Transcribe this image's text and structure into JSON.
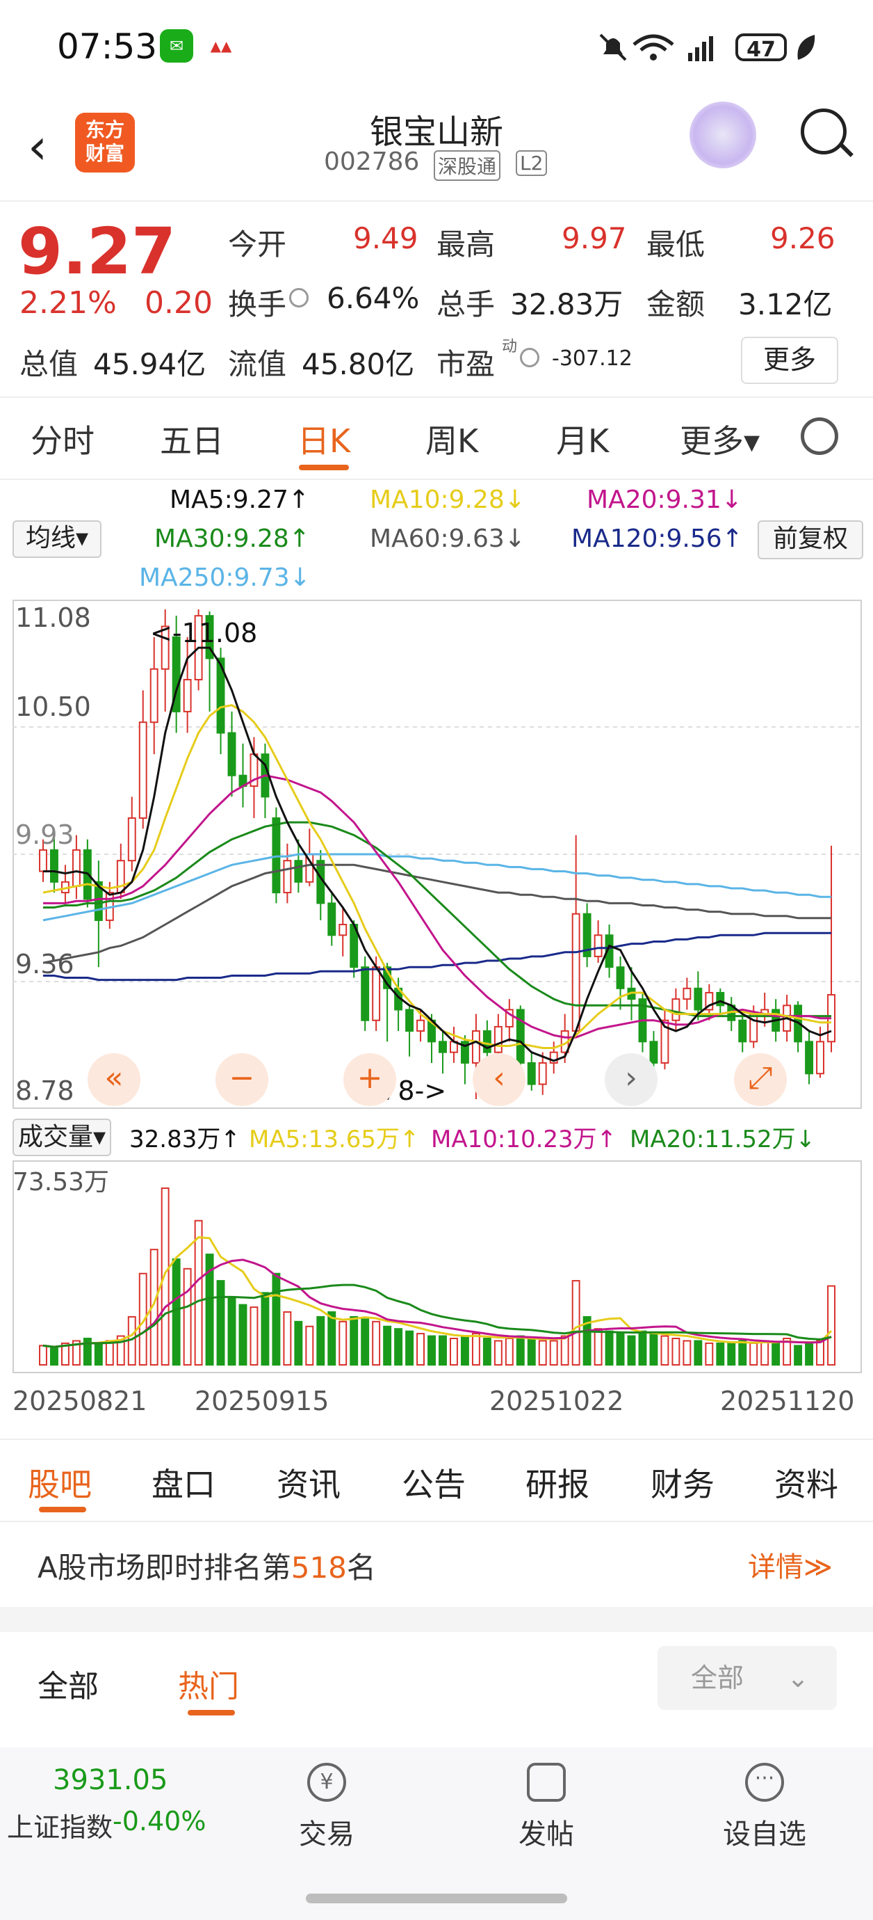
{
  "status_bar": {
    "time": "07:53",
    "battery": "47"
  },
  "header": {
    "logo_text_line1": "东方",
    "logo_text_line2": "财富",
    "stock_name": "银宝山新",
    "stock_code": "002786",
    "tag_connect": "深股通",
    "tag_level": "L2"
  },
  "quote": {
    "price": "9.27",
    "change_pct": "2.21%",
    "change_amt": "0.20",
    "open_label": "今开",
    "open": "9.49",
    "high_label": "最高",
    "high": "9.97",
    "low_label": "最低",
    "low": "9.26",
    "turnover_label": "换手",
    "turnover": "6.64%",
    "volume_label": "总手",
    "volume": "32.83万",
    "amount_label": "金额",
    "amount": "3.12亿",
    "mktcap_label": "总值",
    "mktcap": "45.94亿",
    "float_label": "流值",
    "float_cap": "45.80亿",
    "pe_label": "市盈",
    "pe_sup": "动",
    "pe": "-307.12",
    "more": "更多"
  },
  "k_tabs": [
    "分时",
    "五日",
    "日K",
    "周K",
    "月K",
    "更多▾"
  ],
  "ma_legend": {
    "selector": "均线▾",
    "adjust": "前复权",
    "ma5": "MA5:9.27↑",
    "ma10": "MA10:9.28↓",
    "ma20": "MA20:9.31↓",
    "ma30": "MA30:9.28↑",
    "ma60": "MA60:9.63↓",
    "ma120": "MA120:9.56↑",
    "ma250": "MA250:9.73↓"
  },
  "colors": {
    "up": "#d9322c",
    "down": "#1a9a1a",
    "accent": "#e8641c",
    "ma5": "#111111",
    "ma10": "#e6cc1a",
    "ma20": "#c2158c",
    "ma30": "#1a8a1a",
    "ma60": "#555555",
    "ma120": "#1a2a8a",
    "ma250": "#5ab4e6"
  },
  "price_axis": [
    "11.08",
    "10.50",
    "9.93",
    "9.36",
    "8.78"
  ],
  "price_marks": {
    "max": "<-11.08",
    "min": "8.78->"
  },
  "volume_legend": {
    "selector": "成交量▾",
    "vol": "32.83万↑",
    "ma5": "MA5:13.65万↑",
    "ma10": "MA10:10.23万↑",
    "ma20": "MA20:11.52万↓",
    "max_label": "73.53万"
  },
  "date_axis": [
    "20250821",
    "20250915",
    "20251022",
    "20251120"
  ],
  "chart_data": {
    "type": "candlestick",
    "ylim": [
      8.78,
      11.08
    ],
    "candles": [
      {
        "o": 9.85,
        "c": 9.95,
        "h": 10.0,
        "l": 9.8,
        "v": 8
      },
      {
        "o": 9.95,
        "c": 9.8,
        "h": 10.05,
        "l": 9.75,
        "v": 7
      },
      {
        "o": 9.75,
        "c": 9.8,
        "h": 9.88,
        "l": 9.7,
        "v": 9
      },
      {
        "o": 9.78,
        "c": 9.95,
        "h": 10.02,
        "l": 9.72,
        "v": 10
      },
      {
        "o": 9.95,
        "c": 9.72,
        "h": 10.0,
        "l": 9.68,
        "v": 11
      },
      {
        "o": 9.8,
        "c": 9.62,
        "h": 9.9,
        "l": 9.4,
        "v": 9
      },
      {
        "o": 9.62,
        "c": 9.75,
        "h": 9.8,
        "l": 9.58,
        "v": 10
      },
      {
        "o": 9.75,
        "c": 9.9,
        "h": 9.98,
        "l": 9.72,
        "v": 12
      },
      {
        "o": 9.9,
        "c": 10.1,
        "h": 10.2,
        "l": 9.85,
        "v": 20
      },
      {
        "o": 10.1,
        "c": 10.55,
        "h": 10.7,
        "l": 10.05,
        "v": 38
      },
      {
        "o": 10.55,
        "c": 10.8,
        "h": 10.95,
        "l": 10.4,
        "v": 48
      },
      {
        "o": 10.8,
        "c": 11.0,
        "h": 11.08,
        "l": 10.6,
        "v": 73.53
      },
      {
        "o": 10.95,
        "c": 10.6,
        "h": 11.05,
        "l": 10.5,
        "v": 44
      },
      {
        "o": 10.6,
        "c": 10.75,
        "h": 10.95,
        "l": 10.5,
        "v": 40
      },
      {
        "o": 10.75,
        "c": 11.05,
        "h": 11.08,
        "l": 10.7,
        "v": 60
      },
      {
        "o": 11.05,
        "c": 10.85,
        "h": 11.07,
        "l": 10.6,
        "v": 46
      },
      {
        "o": 10.85,
        "c": 10.5,
        "h": 10.9,
        "l": 10.4,
        "v": 35
      },
      {
        "o": 10.5,
        "c": 10.3,
        "h": 10.6,
        "l": 10.2,
        "v": 28
      },
      {
        "o": 10.3,
        "c": 10.25,
        "h": 10.45,
        "l": 10.15,
        "v": 25
      },
      {
        "o": 10.25,
        "c": 10.4,
        "h": 10.48,
        "l": 10.1,
        "v": 24
      },
      {
        "o": 10.4,
        "c": 10.2,
        "h": 10.45,
        "l": 10.1,
        "v": 30
      },
      {
        "o": 10.1,
        "c": 9.75,
        "h": 10.15,
        "l": 9.7,
        "v": 38
      },
      {
        "o": 9.75,
        "c": 9.9,
        "h": 9.98,
        "l": 9.7,
        "v": 22
      },
      {
        "o": 9.9,
        "c": 9.8,
        "h": 10.0,
        "l": 9.75,
        "v": 18
      },
      {
        "o": 9.8,
        "c": 9.93,
        "h": 10.05,
        "l": 9.78,
        "v": 16
      },
      {
        "o": 9.9,
        "c": 9.7,
        "h": 9.95,
        "l": 9.62,
        "v": 20
      },
      {
        "o": 9.7,
        "c": 9.55,
        "h": 9.75,
        "l": 9.5,
        "v": 22
      },
      {
        "o": 9.55,
        "c": 9.6,
        "h": 9.68,
        "l": 9.45,
        "v": 18
      },
      {
        "o": 9.6,
        "c": 9.4,
        "h": 9.62,
        "l": 9.35,
        "v": 20
      },
      {
        "o": 9.4,
        "c": 9.15,
        "h": 9.45,
        "l": 9.1,
        "v": 19
      },
      {
        "o": 9.15,
        "c": 9.4,
        "h": 9.45,
        "l": 9.1,
        "v": 18
      },
      {
        "o": 9.4,
        "c": 9.3,
        "h": 9.42,
        "l": 9.05,
        "v": 16
      },
      {
        "o": 9.3,
        "c": 9.2,
        "h": 9.35,
        "l": 9.1,
        "v": 15
      },
      {
        "o": 9.2,
        "c": 9.1,
        "h": 9.22,
        "l": 8.98,
        "v": 14
      },
      {
        "o": 9.1,
        "c": 9.15,
        "h": 9.2,
        "l": 9.05,
        "v": 13
      },
      {
        "o": 9.15,
        "c": 9.05,
        "h": 9.18,
        "l": 8.95,
        "v": 12
      },
      {
        "o": 9.05,
        "c": 9.0,
        "h": 9.1,
        "l": 8.9,
        "v": 12
      },
      {
        "o": 9.0,
        "c": 9.05,
        "h": 9.12,
        "l": 8.95,
        "v": 11
      },
      {
        "o": 9.05,
        "c": 8.95,
        "h": 9.08,
        "l": 8.85,
        "v": 12
      },
      {
        "o": 8.95,
        "c": 9.1,
        "h": 9.18,
        "l": 8.78,
        "v": 13
      },
      {
        "o": 9.1,
        "c": 9.0,
        "h": 9.15,
        "l": 8.95,
        "v": 11
      },
      {
        "o": 9.0,
        "c": 9.12,
        "h": 9.18,
        "l": 8.95,
        "v": 10
      },
      {
        "o": 9.12,
        "c": 9.2,
        "h": 9.25,
        "l": 9.05,
        "v": 11
      },
      {
        "o": 9.2,
        "c": 8.95,
        "h": 9.22,
        "l": 8.9,
        "v": 12
      },
      {
        "o": 8.95,
        "c": 8.85,
        "h": 9.0,
        "l": 8.82,
        "v": 11
      },
      {
        "o": 8.85,
        "c": 8.95,
        "h": 9.0,
        "l": 8.8,
        "v": 10
      },
      {
        "o": 8.95,
        "c": 9.0,
        "h": 9.05,
        "l": 8.9,
        "v": 10
      },
      {
        "o": 9.0,
        "c": 9.1,
        "h": 9.18,
        "l": 8.95,
        "v": 12
      },
      {
        "o": 9.1,
        "c": 9.65,
        "h": 10.02,
        "l": 9.08,
        "v": 35
      },
      {
        "o": 9.65,
        "c": 9.45,
        "h": 9.7,
        "l": 9.4,
        "v": 20
      },
      {
        "o": 9.45,
        "c": 9.55,
        "h": 9.62,
        "l": 9.42,
        "v": 15
      },
      {
        "o": 9.55,
        "c": 9.4,
        "h": 9.6,
        "l": 9.35,
        "v": 14
      },
      {
        "o": 9.4,
        "c": 9.3,
        "h": 9.45,
        "l": 9.2,
        "v": 13
      },
      {
        "o": 9.3,
        "c": 9.25,
        "h": 9.4,
        "l": 9.15,
        "v": 12
      },
      {
        "o": 9.25,
        "c": 9.05,
        "h": 9.28,
        "l": 9.0,
        "v": 14
      },
      {
        "o": 9.05,
        "c": 8.95,
        "h": 9.1,
        "l": 8.9,
        "v": 13
      },
      {
        "o": 8.95,
        "c": 9.15,
        "h": 9.2,
        "l": 8.92,
        "v": 12
      },
      {
        "o": 9.15,
        "c": 9.25,
        "h": 9.3,
        "l": 9.1,
        "v": 11
      },
      {
        "o": 9.25,
        "c": 9.3,
        "h": 9.35,
        "l": 9.2,
        "v": 10
      },
      {
        "o": 9.3,
        "c": 9.2,
        "h": 9.38,
        "l": 9.15,
        "v": 10
      },
      {
        "o": 9.2,
        "c": 9.28,
        "h": 9.32,
        "l": 9.15,
        "v": 9
      },
      {
        "o": 9.28,
        "c": 9.22,
        "h": 9.3,
        "l": 9.18,
        "v": 9
      },
      {
        "o": 9.22,
        "c": 9.15,
        "h": 9.26,
        "l": 9.1,
        "v": 9
      },
      {
        "o": 9.15,
        "c": 9.05,
        "h": 9.2,
        "l": 9.0,
        "v": 10
      },
      {
        "o": 9.05,
        "c": 9.18,
        "h": 9.22,
        "l": 9.02,
        "v": 9
      },
      {
        "o": 9.18,
        "c": 9.2,
        "h": 9.28,
        "l": 9.12,
        "v": 10
      },
      {
        "o": 9.2,
        "c": 9.1,
        "h": 9.25,
        "l": 9.05,
        "v": 9
      },
      {
        "o": 9.1,
        "c": 9.22,
        "h": 9.27,
        "l": 9.05,
        "v": 11
      },
      {
        "o": 9.22,
        "c": 9.05,
        "h": 9.24,
        "l": 9.0,
        "v": 8
      },
      {
        "o": 9.05,
        "c": 8.9,
        "h": 9.1,
        "l": 8.85,
        "v": 9
      },
      {
        "o": 8.9,
        "c": 9.05,
        "h": 9.12,
        "l": 8.88,
        "v": 10
      },
      {
        "o": 9.05,
        "c": 9.27,
        "h": 9.97,
        "l": 9.0,
        "v": 32.83
      }
    ],
    "ma_lines": {
      "ma5": [
        9.85,
        9.85,
        9.84,
        9.85,
        9.84,
        9.78,
        9.74,
        9.75,
        9.8,
        9.95,
        10.2,
        10.5,
        10.7,
        10.85,
        10.9,
        10.9,
        10.82,
        10.7,
        10.55,
        10.4,
        10.35,
        10.2,
        10.08,
        9.98,
        9.9,
        9.82,
        9.75,
        9.68,
        9.6,
        9.48,
        9.4,
        9.32,
        9.26,
        9.22,
        9.2,
        9.15,
        9.1,
        9.05,
        9.03,
        9.05,
        9.02,
        9.04,
        9.06,
        9.05,
        9.0,
        8.98,
        8.96,
        8.98,
        9.1,
        9.25,
        9.38,
        9.5,
        9.48,
        9.38,
        9.3,
        9.2,
        9.12,
        9.1,
        9.12,
        9.18,
        9.22,
        9.24,
        9.22,
        9.18,
        9.15,
        9.14,
        9.15,
        9.16,
        9.14,
        9.1,
        9.08,
        9.1
      ],
      "ma10": [
        9.75,
        9.76,
        9.77,
        9.78,
        9.79,
        9.78,
        9.77,
        9.78,
        9.8,
        9.86,
        9.95,
        10.1,
        10.24,
        10.38,
        10.5,
        10.58,
        10.62,
        10.63,
        10.6,
        10.55,
        10.48,
        10.38,
        10.28,
        10.18,
        10.08,
        10.0,
        9.9,
        9.8,
        9.7,
        9.58,
        9.48,
        9.38,
        9.3,
        9.24,
        9.18,
        9.14,
        9.1,
        9.08,
        9.06,
        9.05,
        9.04,
        9.03,
        9.03,
        9.04,
        9.03,
        9.02,
        9.02,
        9.04,
        9.08,
        9.13,
        9.18,
        9.22,
        9.26,
        9.28,
        9.28,
        9.24,
        9.2,
        9.18,
        9.18,
        9.18,
        9.18,
        9.18,
        9.19,
        9.19,
        9.18,
        9.18,
        9.18,
        9.17,
        9.16,
        9.15,
        9.14,
        9.14
      ],
      "ma20": [
        9.7,
        9.7,
        9.7,
        9.71,
        9.71,
        9.72,
        9.72,
        9.73,
        9.75,
        9.78,
        9.83,
        9.88,
        9.94,
        10.0,
        10.06,
        10.12,
        10.17,
        10.22,
        10.25,
        10.28,
        10.3,
        10.29,
        10.28,
        10.26,
        10.24,
        10.22,
        10.18,
        10.13,
        10.08,
        10.01,
        9.94,
        9.87,
        9.8,
        9.72,
        9.64,
        9.56,
        9.48,
        9.42,
        9.36,
        9.31,
        9.26,
        9.22,
        9.18,
        9.15,
        9.12,
        9.1,
        9.08,
        9.07,
        9.07,
        9.09,
        9.11,
        9.12,
        9.13,
        9.14,
        9.15,
        9.15,
        9.14,
        9.13,
        9.13,
        9.14,
        9.16,
        9.18,
        9.19,
        9.2,
        9.19,
        9.18,
        9.17,
        9.17,
        9.17,
        9.17,
        9.16,
        9.16
      ],
      "ma30": [
        9.68,
        9.68,
        9.69,
        9.69,
        9.7,
        9.7,
        9.71,
        9.71,
        9.72,
        9.74,
        9.76,
        9.79,
        9.82,
        9.86,
        9.9,
        9.94,
        9.97,
        10.0,
        10.02,
        10.04,
        10.06,
        10.07,
        10.08,
        10.08,
        10.08,
        10.07,
        10.06,
        10.04,
        10.02,
        9.99,
        9.96,
        9.92,
        9.88,
        9.84,
        9.79,
        9.74,
        9.69,
        9.64,
        9.59,
        9.54,
        9.49,
        9.44,
        9.39,
        9.35,
        9.31,
        9.28,
        9.25,
        9.23,
        9.22,
        9.22,
        9.22,
        9.22,
        9.22,
        9.22,
        9.22,
        9.21,
        9.2,
        9.19,
        9.18,
        9.17,
        9.17,
        9.17,
        9.17,
        9.17,
        9.17,
        9.17,
        9.17,
        9.17,
        9.17,
        9.17,
        9.17,
        9.17
      ],
      "ma60": [
        9.42,
        9.43,
        9.44,
        9.45,
        9.46,
        9.47,
        9.49,
        9.5,
        9.52,
        9.54,
        9.57,
        9.6,
        9.63,
        9.66,
        9.69,
        9.72,
        9.75,
        9.78,
        9.8,
        9.82,
        9.84,
        9.85,
        9.86,
        9.87,
        9.88,
        9.88,
        9.88,
        9.88,
        9.88,
        9.87,
        9.86,
        9.85,
        9.84,
        9.83,
        9.82,
        9.81,
        9.8,
        9.79,
        9.78,
        9.77,
        9.76,
        9.75,
        9.75,
        9.74,
        9.74,
        9.73,
        9.73,
        9.72,
        9.72,
        9.71,
        9.71,
        9.7,
        9.7,
        9.7,
        9.69,
        9.69,
        9.68,
        9.68,
        9.67,
        9.67,
        9.66,
        9.66,
        9.65,
        9.65,
        9.65,
        9.64,
        9.64,
        9.64,
        9.63,
        9.63,
        9.63,
        9.63
      ],
      "ma120": [
        9.36,
        9.36,
        9.35,
        9.35,
        9.35,
        9.34,
        9.34,
        9.34,
        9.34,
        9.34,
        9.34,
        9.34,
        9.34,
        9.35,
        9.35,
        9.35,
        9.35,
        9.36,
        9.36,
        9.36,
        9.36,
        9.37,
        9.37,
        9.37,
        9.37,
        9.38,
        9.38,
        9.38,
        9.38,
        9.39,
        9.39,
        9.39,
        9.39,
        9.4,
        9.4,
        9.4,
        9.41,
        9.41,
        9.42,
        9.42,
        9.43,
        9.43,
        9.44,
        9.44,
        9.45,
        9.45,
        9.46,
        9.47,
        9.47,
        9.48,
        9.49,
        9.49,
        9.5,
        9.51,
        9.51,
        9.52,
        9.52,
        9.53,
        9.53,
        9.54,
        9.54,
        9.55,
        9.55,
        9.55,
        9.55,
        9.56,
        9.56,
        9.56,
        9.56,
        9.56,
        9.56,
        9.56
      ],
      "ma250": [
        9.62,
        9.63,
        9.64,
        9.65,
        9.66,
        9.67,
        9.68,
        9.69,
        9.7,
        9.72,
        9.74,
        9.76,
        9.78,
        9.8,
        9.82,
        9.84,
        9.86,
        9.88,
        9.89,
        9.9,
        9.91,
        9.92,
        9.92,
        9.93,
        9.93,
        9.93,
        9.93,
        9.93,
        9.93,
        9.93,
        9.93,
        9.92,
        9.92,
        9.92,
        9.91,
        9.91,
        9.9,
        9.9,
        9.89,
        9.89,
        9.88,
        9.88,
        9.87,
        9.87,
        9.86,
        9.86,
        9.85,
        9.85,
        9.84,
        9.84,
        9.83,
        9.83,
        9.82,
        9.82,
        9.81,
        9.81,
        9.8,
        9.8,
        9.79,
        9.79,
        9.78,
        9.78,
        9.77,
        9.77,
        9.76,
        9.76,
        9.75,
        9.75,
        9.74,
        9.74,
        9.73,
        9.73
      ]
    }
  },
  "section_tabs": [
    "股吧",
    "盘口",
    "资讯",
    "公告",
    "研报",
    "财务",
    "资料"
  ],
  "rank": {
    "prefix": "A股市场即时排名第",
    "num": "518",
    "suffix": "名",
    "detail": "详情≫"
  },
  "post_tabs": {
    "all": "全部",
    "hot": "热门",
    "filter": "全部"
  },
  "bottom_bar": {
    "index_value": "3931.05",
    "index_name": "上证指数",
    "index_change": "-0.40%",
    "trade": "交易",
    "post": "发帖",
    "watch": "设自选"
  }
}
